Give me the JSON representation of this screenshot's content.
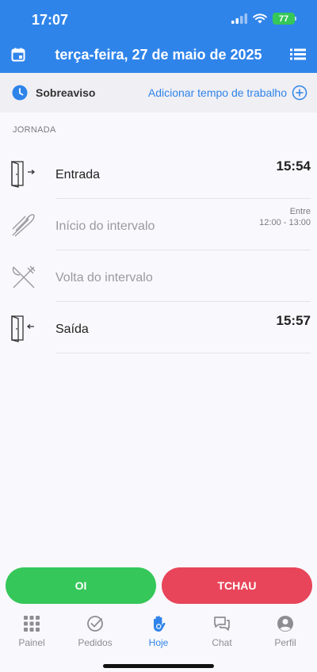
{
  "status_bar": {
    "time": "17:07",
    "battery": "77"
  },
  "header": {
    "title": "terça-feira, 27 de maio de 2025"
  },
  "subbar": {
    "standby_label": "Sobreaviso",
    "add_work_label": "Adicionar tempo de trabalho"
  },
  "section": {
    "label": "JORNADA"
  },
  "entries": [
    {
      "label": "Entrada",
      "time": "15:54"
    },
    {
      "label": "Início do intervalo",
      "between_label": "Entre",
      "between_range": "12:00 - 13:00"
    },
    {
      "label": "Volta do intervalo"
    },
    {
      "label": "Saída",
      "time": "15:57"
    }
  ],
  "actions": {
    "in_label": "OI",
    "out_label": "TCHAU"
  },
  "tabs": [
    {
      "label": "Painel",
      "icon": "grid-icon"
    },
    {
      "label": "Pedidos",
      "icon": "check-circle-icon"
    },
    {
      "label": "Hoje",
      "icon": "hand-icon"
    },
    {
      "label": "Chat",
      "icon": "chat-icon"
    },
    {
      "label": "Perfil",
      "icon": "person-icon"
    }
  ],
  "colors": {
    "primary": "#2f84ea",
    "green": "#35c759",
    "red": "#e8455a"
  }
}
